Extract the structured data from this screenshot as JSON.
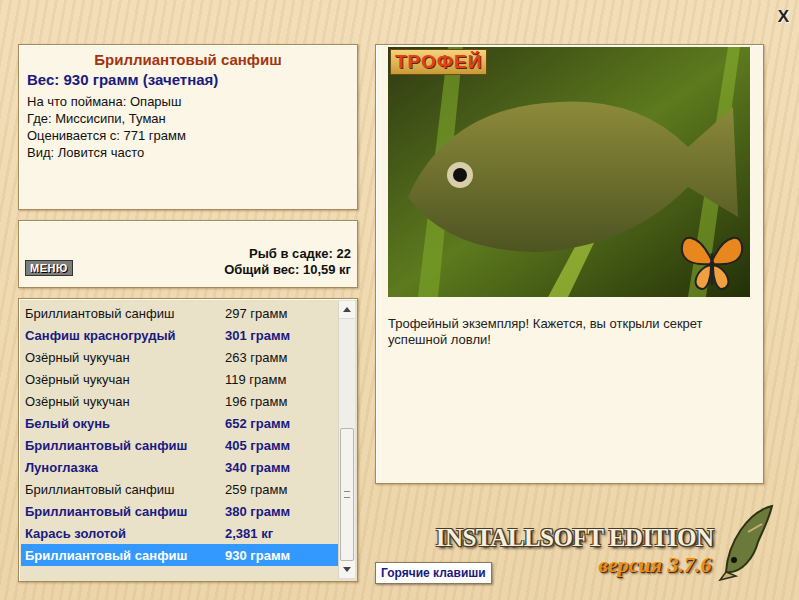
{
  "window": {
    "close": "X"
  },
  "fish": {
    "name": "Бриллиантовый санфиш",
    "weight": "Вес: 930 грамм (зачетная)",
    "details": [
      "На что поймана: Опарыш",
      "Где: Миссисипи, Туман",
      "Оценивается с: 771 грамм",
      "Вид: Ловится часто"
    ]
  },
  "menu_button": "МЕНЮ",
  "stats": [
    "Рыб в садке: 22",
    "Общий вес: 10,59 кг"
  ],
  "catch_list": [
    {
      "name": "Бриллиантовый санфиш",
      "weight": "297 грамм",
      "bold": false,
      "selected": false
    },
    {
      "name": "Санфиш красногрудый",
      "weight": "301 грамм",
      "bold": true,
      "selected": false
    },
    {
      "name": "Озёрный чукучан",
      "weight": "263 грамм",
      "bold": false,
      "selected": false
    },
    {
      "name": "Озёрный чукучан",
      "weight": "119 грамм",
      "bold": false,
      "selected": false
    },
    {
      "name": "Озёрный чукучан",
      "weight": "196 грамм",
      "bold": false,
      "selected": false
    },
    {
      "name": "Белый окунь",
      "weight": "652 грамм",
      "bold": true,
      "selected": false
    },
    {
      "name": "Бриллиантовый санфиш",
      "weight": "405 грамм",
      "bold": true,
      "selected": false
    },
    {
      "name": "Луноглазка",
      "weight": "340 грамм",
      "bold": true,
      "selected": false
    },
    {
      "name": "Бриллиантовый санфиш",
      "weight": "259 грамм",
      "bold": false,
      "selected": false
    },
    {
      "name": "Бриллиантовый санфиш",
      "weight": "380 грамм",
      "bold": true,
      "selected": false
    },
    {
      "name": "Карась золотой",
      "weight": "2,381 кг",
      "bold": true,
      "selected": false
    },
    {
      "name": "Бриллиантовый санфиш",
      "weight": "930 грамм",
      "bold": true,
      "selected": true
    }
  ],
  "scrollbar": {
    "level": 1
  },
  "photo": {
    "badge": "ТРОФЕЙ"
  },
  "message": "Трофейный экземпляр! Кажется, вы открыли секрет успешной ловли!",
  "hotkeys_button": "Горячие клавиши",
  "brand": {
    "title": "INSTALLSOFT EDITION",
    "version": "версия 3.7.6"
  }
}
